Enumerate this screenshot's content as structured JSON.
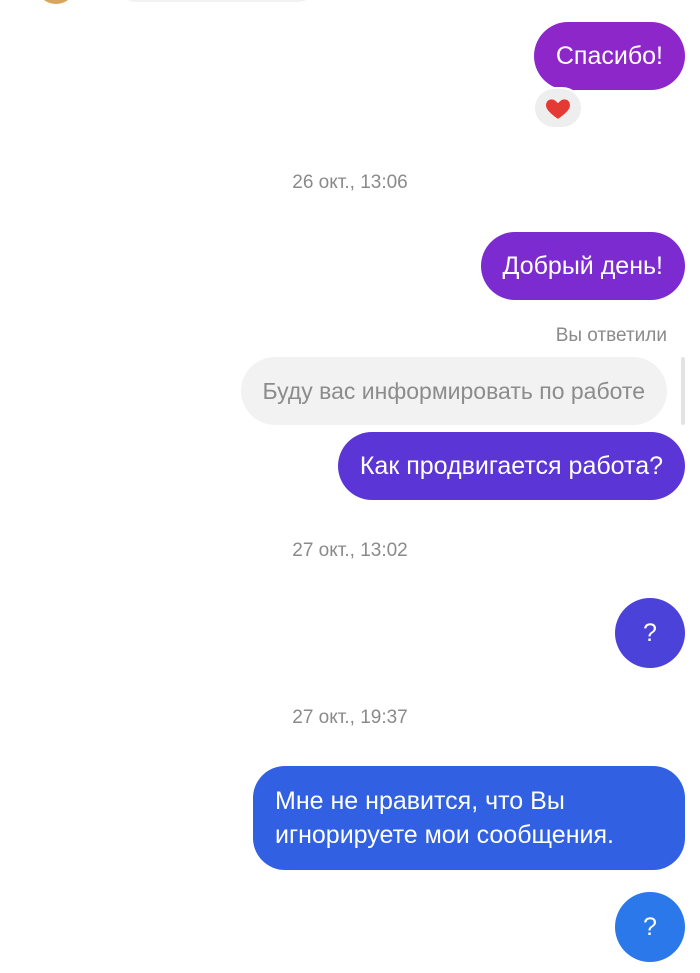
{
  "conversation": {
    "messages": [
      {
        "text": "Спасибо!",
        "reaction": "heart-icon"
      },
      {
        "text": "Добрый день!"
      },
      {
        "text": "Как продвигается работа?",
        "reply_label": "Вы ответили",
        "quoted_text": "Буду вас информировать по работе"
      },
      {
        "text": "?"
      },
      {
        "text": "Мне не нравится, что Вы игнорируете мои сообщения."
      },
      {
        "text": "?"
      }
    ],
    "timestamps": [
      "26 окт., 13:06",
      "27 окт., 13:02",
      "27 окт., 19:37"
    ]
  },
  "colors": {
    "bubble_1": "#8e27c9",
    "bubble_2": "#7b2bd0",
    "bubble_3": "#5b35d6",
    "bubble_4": "#4a42d9",
    "bubble_5": "#3160e3",
    "bubble_6": "#2a78ea",
    "quoted_bg": "#f2f2f2",
    "timestamp_text": "#8a8a8a",
    "reaction": "#e53935"
  }
}
